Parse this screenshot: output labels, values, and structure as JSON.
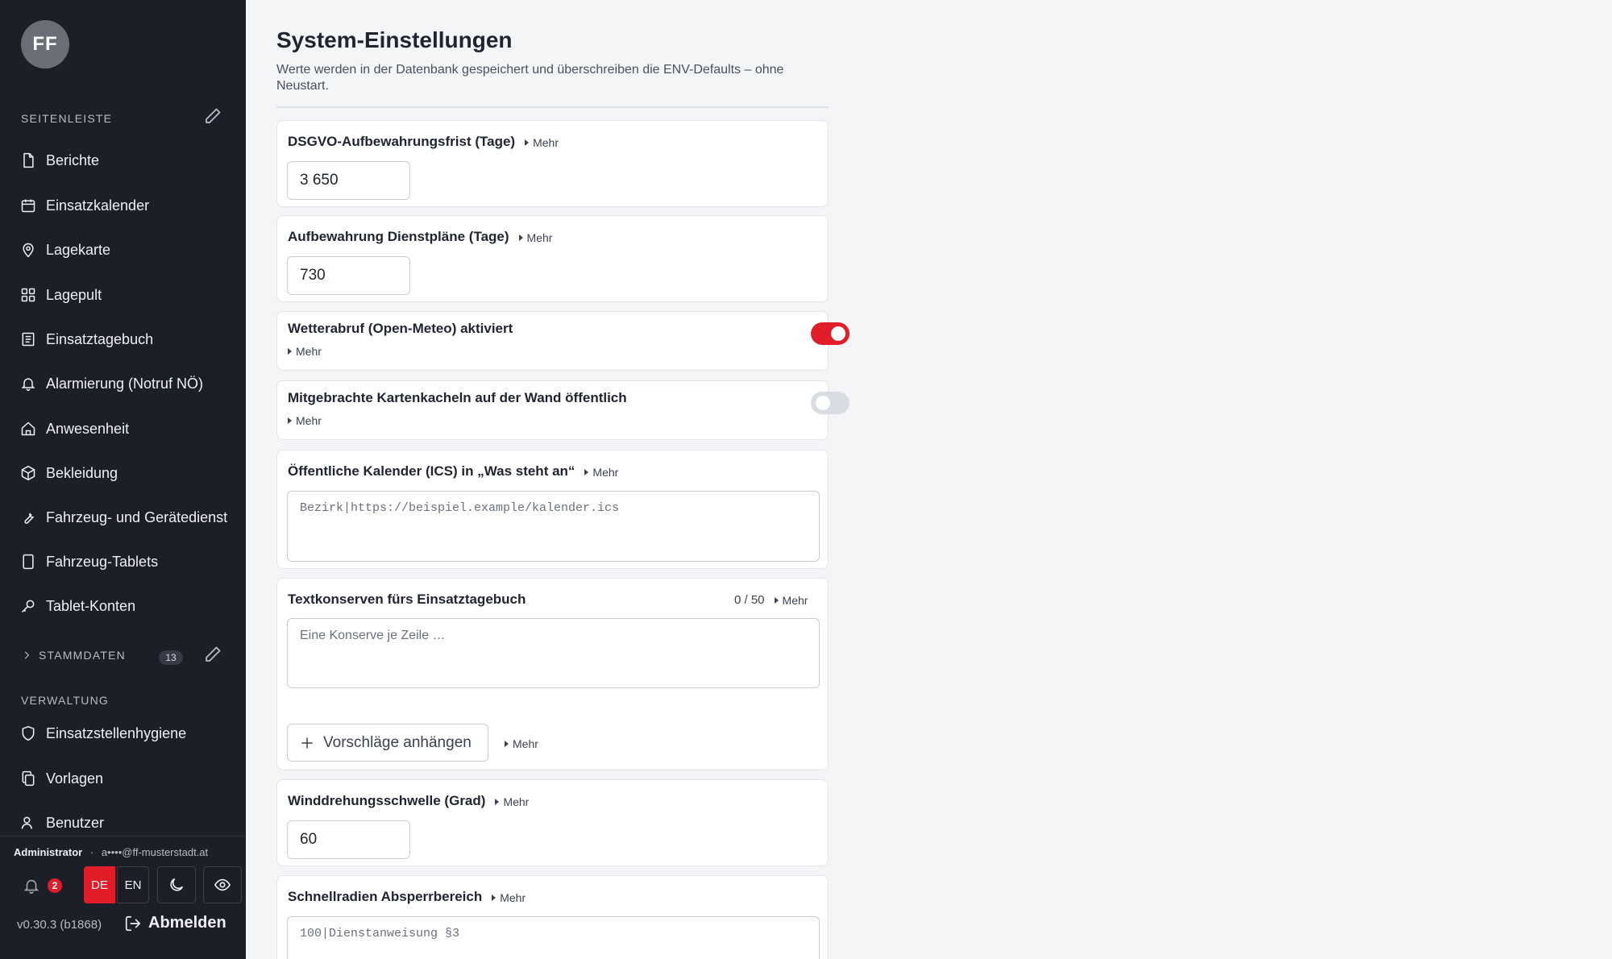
{
  "user": {
    "initials": "FF",
    "role": "Administrator",
    "email": "a••••@ff-musterstadt.at"
  },
  "sidebar": {
    "section_title": "Seitenleiste",
    "items": [
      {
        "label": "Berichte",
        "icon": "file-icon"
      },
      {
        "label": "Einsatzkalender",
        "icon": "calendar-icon"
      },
      {
        "label": "Lagekarte",
        "icon": "map-pin-icon"
      },
      {
        "label": "Lagepult",
        "icon": "grid-icon"
      },
      {
        "label": "Einsatztagebuch",
        "icon": "list-document-icon"
      },
      {
        "label": "Alarmierung (Notruf NÖ)",
        "icon": "bell-icon"
      },
      {
        "label": "Anwesenheit",
        "icon": "home-icon"
      },
      {
        "label": "Bekleidung",
        "icon": "package-icon"
      },
      {
        "label": "Fahrzeug- und Gerätedienst",
        "icon": "wrench-icon"
      },
      {
        "label": "Fahrzeug-Tablets",
        "icon": "tablet-icon"
      },
      {
        "label": "Tablet-Konten",
        "icon": "key-icon"
      }
    ],
    "stammdaten": {
      "label": "Stammdaten",
      "count": "13"
    },
    "verwaltung": {
      "label": "Verwaltung",
      "items": [
        {
          "label": "Einsatzstellenhygiene",
          "icon": "shield-icon"
        },
        {
          "label": "Vorlagen",
          "icon": "copy-icon"
        },
        {
          "label": "Benutzer",
          "icon": "user-icon"
        }
      ]
    },
    "footer": {
      "notification_count": "2",
      "lang_de": "DE",
      "lang_en": "EN",
      "version": "v0.30.3 (b1868)",
      "logout": "Abmelden"
    }
  },
  "main": {
    "title": "System-Einstellungen",
    "subtitle": "Werte werden in der Datenbank gespeichert und überschreiben die ENV-Defaults – ohne Neustart.",
    "mehr": "Mehr",
    "settings": {
      "dsgvo": {
        "label": "DSGVO-Aufbewahrungsfrist (Tage)",
        "value": "3 650"
      },
      "dienstplaene": {
        "label": "Aufbewahrung Dienstpläne (Tage)",
        "value": "730"
      },
      "wetter": {
        "label": "Wetterabruf (Open-Meteo) aktiviert",
        "enabled": true
      },
      "kartenkacheln": {
        "label": "Mitgebrachte Kartenkacheln auf der Wand öffentlich",
        "enabled": false
      },
      "ics": {
        "label": "Öffentliche Kalender (ICS) in „Was steht an“",
        "placeholder": "Bezirk|https://beispiel.example/kalender.ics"
      },
      "textkonserven": {
        "label": "Textkonserven fürs Einsatztagebuch",
        "counter": "0 / 50",
        "placeholder": "Eine Konserve je Zeile …",
        "add_label": "Vorschläge anhängen"
      },
      "winddrehung": {
        "label": "Winddrehungsschwelle (Grad)",
        "value": "60"
      },
      "schnellradien": {
        "label": "Schnellradien Absperrbereich",
        "placeholder": "100|Dienstanweisung §3"
      }
    }
  }
}
